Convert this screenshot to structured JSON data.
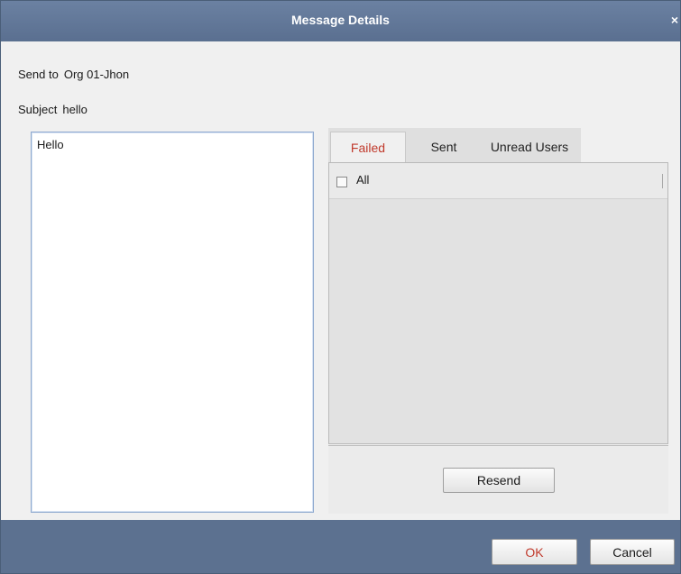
{
  "dialog": {
    "title": "Message Details",
    "close_glyph": "×"
  },
  "fields": {
    "send_to_label": "Send to",
    "send_to_value": "Org 01-Jhon",
    "subject_label": "Subject",
    "subject_value": "hello"
  },
  "message": {
    "body": "Hello"
  },
  "recipients": {
    "tabs": [
      {
        "label": "Failed",
        "active": true
      },
      {
        "label": "Sent",
        "active": false
      },
      {
        "label": "Unread Users",
        "active": false
      }
    ],
    "select_all_label": "All",
    "select_all_checked": false,
    "resend_label": "Resend"
  },
  "footer": {
    "ok_label": "OK",
    "cancel_label": "Cancel"
  },
  "colors": {
    "titlebar": "#6b81a2",
    "footer": "#5c7190",
    "active_tab_text": "#c0392b",
    "ok_text": "#c0392b"
  }
}
